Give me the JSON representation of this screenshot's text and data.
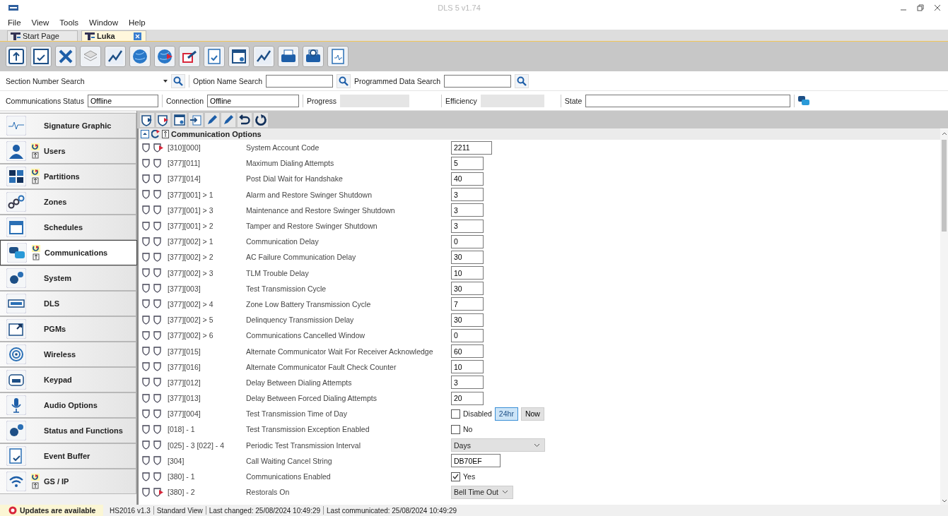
{
  "window": {
    "title": "DLS 5 v1.74"
  },
  "menu": [
    "File",
    "View",
    "Tools",
    "Window",
    "Help"
  ],
  "tabs": [
    {
      "label": "Start Page",
      "selected": false,
      "closable": false
    },
    {
      "label": "Luka",
      "selected": true,
      "closable": true
    }
  ],
  "search": {
    "section_label": "Section Number Search",
    "option_label": "Option Name Search",
    "data_label": "Programmed Data Search"
  },
  "status_fields": [
    {
      "label": "Communications Status",
      "value": "Offline",
      "disabled": false
    },
    {
      "label": "Connection",
      "value": "Offline",
      "disabled": false
    },
    {
      "label": "Progress",
      "disabled": true
    },
    {
      "label": "Efficiency",
      "disabled": true
    },
    {
      "label": "State",
      "disabled": false
    }
  ],
  "sidebar": [
    {
      "label": "Signature Graphic",
      "selected": false,
      "flagged": false
    },
    {
      "label": "Users",
      "selected": false,
      "flagged": true
    },
    {
      "label": "Partitions",
      "selected": false,
      "flagged": true
    },
    {
      "label": "Zones",
      "selected": false,
      "flagged": false
    },
    {
      "label": "Schedules",
      "selected": false,
      "flagged": false
    },
    {
      "label": "Communications",
      "selected": true,
      "flagged": true
    },
    {
      "label": "System",
      "selected": false,
      "flagged": false
    },
    {
      "label": "DLS",
      "selected": false,
      "flagged": false
    },
    {
      "label": "PGMs",
      "selected": false,
      "flagged": false
    },
    {
      "label": "Wireless",
      "selected": false,
      "flagged": false
    },
    {
      "label": "Keypad",
      "selected": false,
      "flagged": false
    },
    {
      "label": "Audio Options",
      "selected": false,
      "flagged": false
    },
    {
      "label": "Status and Functions",
      "selected": false,
      "flagged": false
    },
    {
      "label": "Event Buffer",
      "selected": false,
      "flagged": false
    },
    {
      "label": "GS / IP",
      "selected": false,
      "flagged": true
    }
  ],
  "group": {
    "title": "Communication Options"
  },
  "rows": [
    {
      "section": "[310][000]",
      "name": "System Account Code",
      "modified": true,
      "kind": "text",
      "value": "2211"
    },
    {
      "section": "[377][011]",
      "name": "Maximum Dialing Attempts",
      "modified": false,
      "kind": "text",
      "value": "5"
    },
    {
      "section": "[377][014]",
      "name": "Post Dial Wait for Handshake",
      "modified": false,
      "kind": "text",
      "value": "40"
    },
    {
      "section": "[377][001] > 1",
      "name": "Alarm and Restore Swinger Shutdown",
      "modified": false,
      "kind": "text",
      "value": "3"
    },
    {
      "section": "[377][001] > 3",
      "name": "Maintenance and Restore Swinger Shutdown",
      "modified": false,
      "kind": "text",
      "value": "3"
    },
    {
      "section": "[377][001] > 2",
      "name": "Tamper and Restore Swinger Shutdown",
      "modified": false,
      "kind": "text",
      "value": "3"
    },
    {
      "section": "[377][002] > 1",
      "name": "Communication Delay",
      "modified": false,
      "kind": "text",
      "value": "0"
    },
    {
      "section": "[377][002] > 2",
      "name": "AC Failure Communication Delay",
      "modified": false,
      "kind": "text",
      "value": "30"
    },
    {
      "section": "[377][002] > 3",
      "name": "TLM Trouble Delay",
      "modified": false,
      "kind": "text",
      "value": "10"
    },
    {
      "section": "[377][003]",
      "name": "Test Transmission Cycle",
      "modified": false,
      "kind": "text",
      "value": "30"
    },
    {
      "section": "[377][002] > 4",
      "name": "Zone Low Battery Transmission Cycle",
      "modified": false,
      "kind": "text",
      "value": "7"
    },
    {
      "section": "[377][002] > 5",
      "name": "Delinquency Transmission Delay",
      "modified": false,
      "kind": "text",
      "value": "30"
    },
    {
      "section": "[377][002] > 6",
      "name": "Communications Cancelled Window",
      "modified": false,
      "kind": "text",
      "value": "0"
    },
    {
      "section": "[377][015]",
      "name": "Alternate Communicator Wait For Receiver Acknowledge",
      "modified": false,
      "kind": "text",
      "value": "60"
    },
    {
      "section": "[377][016]",
      "name": "Alternate Communicator Fault Check Counter",
      "modified": false,
      "kind": "text",
      "value": "10"
    },
    {
      "section": "[377][012]",
      "name": "Delay Between Dialing Attempts",
      "modified": false,
      "kind": "text",
      "value": "3"
    },
    {
      "section": "[377][013]",
      "name": "Delay Between Forced Dialing Attempts",
      "modified": false,
      "kind": "text",
      "value": "20"
    },
    {
      "section": "[377][004]",
      "name": "Test Transmission Time of Day",
      "modified": false,
      "kind": "time",
      "checked": false,
      "label": "Disabled",
      "buttons": [
        {
          "label": "24hr",
          "selected": true
        },
        {
          "label": "Now",
          "selected": false
        }
      ]
    },
    {
      "section": "[018] - 1",
      "name": "Test Transmission Exception Enabled",
      "modified": false,
      "kind": "checkbox",
      "checked": false,
      "label": "No"
    },
    {
      "section": "[025] - 3 [022] - 4",
      "name": "Periodic Test Transmission Interval",
      "modified": false,
      "kind": "select",
      "value": "Days"
    },
    {
      "section": "[304]",
      "name": "Call Waiting Cancel String",
      "modified": false,
      "kind": "text",
      "value": "DB70EF"
    },
    {
      "section": "[380] - 1",
      "name": "Communications Enabled",
      "modified": false,
      "kind": "checkbox",
      "checked": true,
      "label": "Yes"
    },
    {
      "section": "[380] - 2",
      "name": "Restorals On",
      "modified": true,
      "kind": "select",
      "value": "Bell Time Out"
    }
  ],
  "status_bar": {
    "notice": "Updates are available",
    "items": [
      "HS2016 v1.3",
      "Standard View",
      "Last changed: 25/08/2024 10:49:29",
      "Last communicated: 25/08/2024 10:49:29"
    ]
  }
}
